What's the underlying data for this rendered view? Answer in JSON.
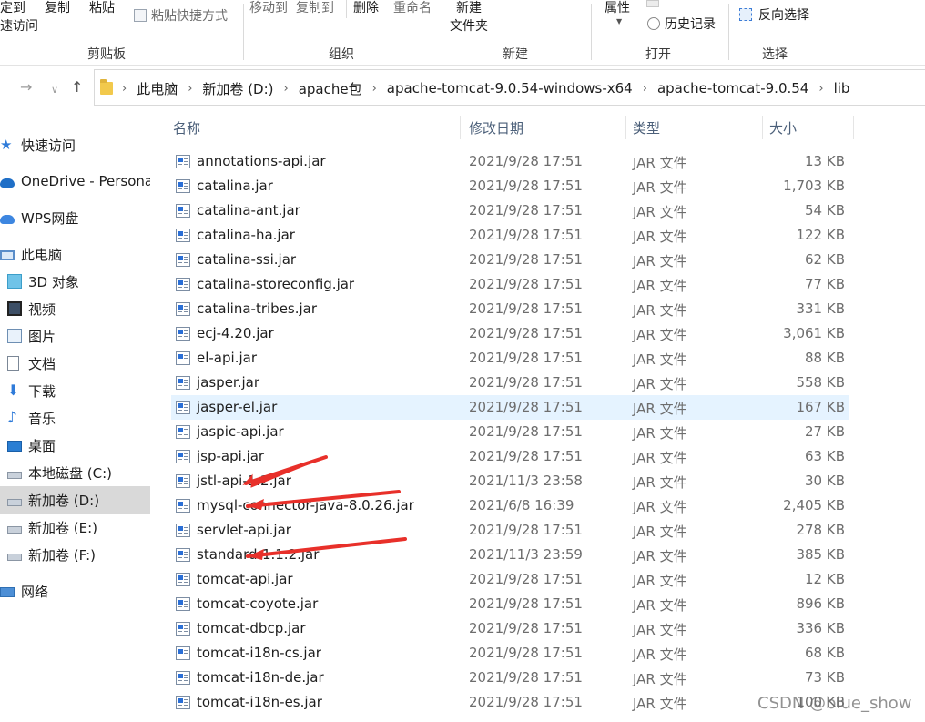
{
  "ribbon": {
    "pin_label_line1": "定到",
    "pin_label_line2": "速访问",
    "copy_label": "复制",
    "paste_label": "粘贴",
    "paste_shortcut_label": "粘贴快捷方式",
    "move_to_label": "移动到",
    "copy_to_label": "复制到",
    "delete_label": "删除",
    "rename_label": "重命名",
    "new_folder_line1": "新建",
    "new_folder_line2": "文件夹",
    "properties_label": "属性",
    "history_label": "历史记录",
    "invert_selection_label": "反向选择",
    "groups": {
      "clipboard": "剪贴板",
      "organize": "组织",
      "new": "新建",
      "open": "打开",
      "select": "选择"
    }
  },
  "address": {
    "crumbs": [
      "此电脑",
      "新加卷 (D:)",
      "apache包",
      "apache-tomcat-9.0.54-windows-x64",
      "apache-tomcat-9.0.54",
      "lib"
    ]
  },
  "sidebar": {
    "quick_access": "快速访问",
    "onedrive": "OneDrive - Persona",
    "wps": "WPS网盘",
    "this_pc": "此电脑",
    "objects3d": "3D 对象",
    "videos": "视频",
    "pictures": "图片",
    "documents": "文档",
    "downloads": "下载",
    "music": "音乐",
    "desktop": "桌面",
    "drive_c": "本地磁盘 (C:)",
    "drive_d": "新加卷 (D:)",
    "drive_e": "新加卷 (E:)",
    "drive_f": "新加卷 (F:)",
    "network": "网络"
  },
  "columns": {
    "name": "名称",
    "modified": "修改日期",
    "type": "类型",
    "size": "大小"
  },
  "files": [
    {
      "name": "annotations-api.jar",
      "date": "2021/9/28 17:51",
      "type": "JAR 文件",
      "size": "13 KB"
    },
    {
      "name": "catalina.jar",
      "date": "2021/9/28 17:51",
      "type": "JAR 文件",
      "size": "1,703 KB"
    },
    {
      "name": "catalina-ant.jar",
      "date": "2021/9/28 17:51",
      "type": "JAR 文件",
      "size": "54 KB"
    },
    {
      "name": "catalina-ha.jar",
      "date": "2021/9/28 17:51",
      "type": "JAR 文件",
      "size": "122 KB"
    },
    {
      "name": "catalina-ssi.jar",
      "date": "2021/9/28 17:51",
      "type": "JAR 文件",
      "size": "62 KB"
    },
    {
      "name": "catalina-storeconfig.jar",
      "date": "2021/9/28 17:51",
      "type": "JAR 文件",
      "size": "77 KB"
    },
    {
      "name": "catalina-tribes.jar",
      "date": "2021/9/28 17:51",
      "type": "JAR 文件",
      "size": "331 KB"
    },
    {
      "name": "ecj-4.20.jar",
      "date": "2021/9/28 17:51",
      "type": "JAR 文件",
      "size": "3,061 KB"
    },
    {
      "name": "el-api.jar",
      "date": "2021/9/28 17:51",
      "type": "JAR 文件",
      "size": "88 KB"
    },
    {
      "name": "jasper.jar",
      "date": "2021/9/28 17:51",
      "type": "JAR 文件",
      "size": "558 KB"
    },
    {
      "name": "jasper-el.jar",
      "date": "2021/9/28 17:51",
      "type": "JAR 文件",
      "size": "167 KB"
    },
    {
      "name": "jaspic-api.jar",
      "date": "2021/9/28 17:51",
      "type": "JAR 文件",
      "size": "27 KB"
    },
    {
      "name": "jsp-api.jar",
      "date": "2021/9/28 17:51",
      "type": "JAR 文件",
      "size": "63 KB"
    },
    {
      "name": "jstl-api-1.2.jar",
      "date": "2021/11/3 23:58",
      "type": "JAR 文件",
      "size": "30 KB"
    },
    {
      "name": "mysql-connector-java-8.0.26.jar",
      "date": "2021/6/8 16:39",
      "type": "JAR 文件",
      "size": "2,405 KB"
    },
    {
      "name": "servlet-api.jar",
      "date": "2021/9/28 17:51",
      "type": "JAR 文件",
      "size": "278 KB"
    },
    {
      "name": "standard-1.1.2.jar",
      "date": "2021/11/3 23:59",
      "type": "JAR 文件",
      "size": "385 KB"
    },
    {
      "name": "tomcat-api.jar",
      "date": "2021/9/28 17:51",
      "type": "JAR 文件",
      "size": "12 KB"
    },
    {
      "name": "tomcat-coyote.jar",
      "date": "2021/9/28 17:51",
      "type": "JAR 文件",
      "size": "896 KB"
    },
    {
      "name": "tomcat-dbcp.jar",
      "date": "2021/9/28 17:51",
      "type": "JAR 文件",
      "size": "336 KB"
    },
    {
      "name": "tomcat-i18n-cs.jar",
      "date": "2021/9/28 17:51",
      "type": "JAR 文件",
      "size": "68 KB"
    },
    {
      "name": "tomcat-i18n-de.jar",
      "date": "2021/9/28 17:51",
      "type": "JAR 文件",
      "size": "73 KB"
    },
    {
      "name": "tomcat-i18n-es.jar",
      "date": "2021/9/28 17:51",
      "type": "JAR 文件",
      "size": "100 KB"
    }
  ],
  "watermark": "CSDN @blue_show",
  "colors": {
    "hover_row": "#e5f3ff",
    "selected_drive": "#d9d9d9",
    "annotation_arrow": "#e8302a"
  }
}
